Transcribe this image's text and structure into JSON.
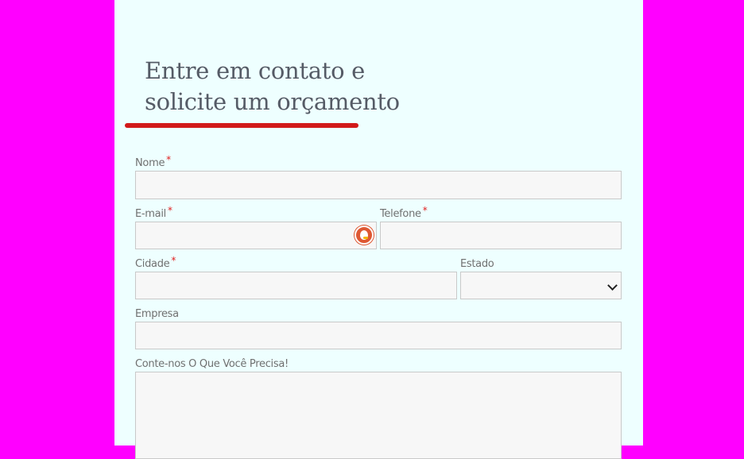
{
  "heading": {
    "line1": "Entre em contato e",
    "line2": "solicite um orçamento"
  },
  "form": {
    "name_label": "Nome",
    "email_label": "E-mail",
    "phone_label": "Telefone",
    "city_label": "Cidade",
    "state_label": "Estado",
    "company_label": "Empresa",
    "message_label": "Conte-nos O Que Você Precisa!",
    "required_mark": "*",
    "name_value": "",
    "email_value": "",
    "phone_value": "",
    "city_value": "",
    "state_value": "",
    "company_value": "",
    "message_value": ""
  },
  "colors": {
    "page_background": "#ff00ff",
    "panel_background": "#eeffff",
    "accent": "#d11a1a",
    "required": "#e02020"
  },
  "icons": {
    "email_autofill": "duckduckgo-icon",
    "select_arrow": "chevron-down-icon"
  }
}
